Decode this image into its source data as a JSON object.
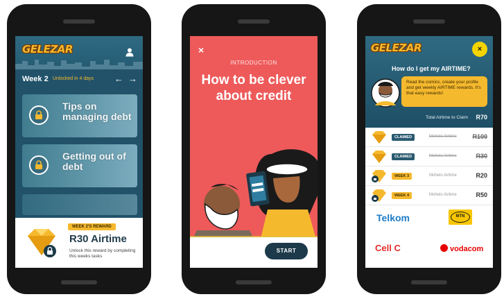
{
  "colors": {
    "brand_gold": "#f5b92e",
    "teal_dark": "#21526a",
    "coral": "#ee5a5a",
    "navy_button": "#1c3a4a"
  },
  "screen1": {
    "logo": "GELEZAR",
    "user_icon": "user-icon",
    "week_label": "Week 2",
    "week_sub": "Unlocked in 4 days",
    "prev_arrow": "←",
    "next_arrow": "→",
    "cards": [
      {
        "title": "Tips on managing debt",
        "icon": "lock-icon"
      },
      {
        "title": "Getting out of debt",
        "icon": "lock-icon"
      }
    ],
    "reward": {
      "tag": "WEEK 2'S REWARD",
      "title": "R30 Airtime",
      "description": "Unlock this reward by completing this weeks tasks"
    }
  },
  "screen2": {
    "close": "×",
    "intro_label": "INTRODUCTION",
    "title_line1": "How to be clever",
    "title_line2": "about credit",
    "start_button": "START"
  },
  "screen3": {
    "logo": "GELEZAR",
    "close": "×",
    "faq_title": "How do I get my AIRTIME?",
    "bubble_text": "Read the comics, create your profile and get weekly AIRTIME rewards. It's that easy rewards!",
    "total_label": "Total Airtime to Claim",
    "total_value": "R70",
    "rewards": [
      {
        "tag": "CLAIMED",
        "name": "Mohelo Airtime",
        "value": "R100",
        "claimed": true
      },
      {
        "tag": "CLAIMED",
        "name": "Mohelo Airtime",
        "value": "R30",
        "claimed": true
      },
      {
        "tag": "WEEK 3",
        "name": "Mohelo Airtime",
        "value": "R20",
        "claimed": false
      },
      {
        "tag": "WEEK 4",
        "name": "Mohelo Airtime",
        "value": "R50",
        "claimed": false
      }
    ],
    "partners": {
      "telkom": "Telkom",
      "mtn": "MTN",
      "cellc": "Cell C",
      "vodacom": "vodacom"
    }
  }
}
